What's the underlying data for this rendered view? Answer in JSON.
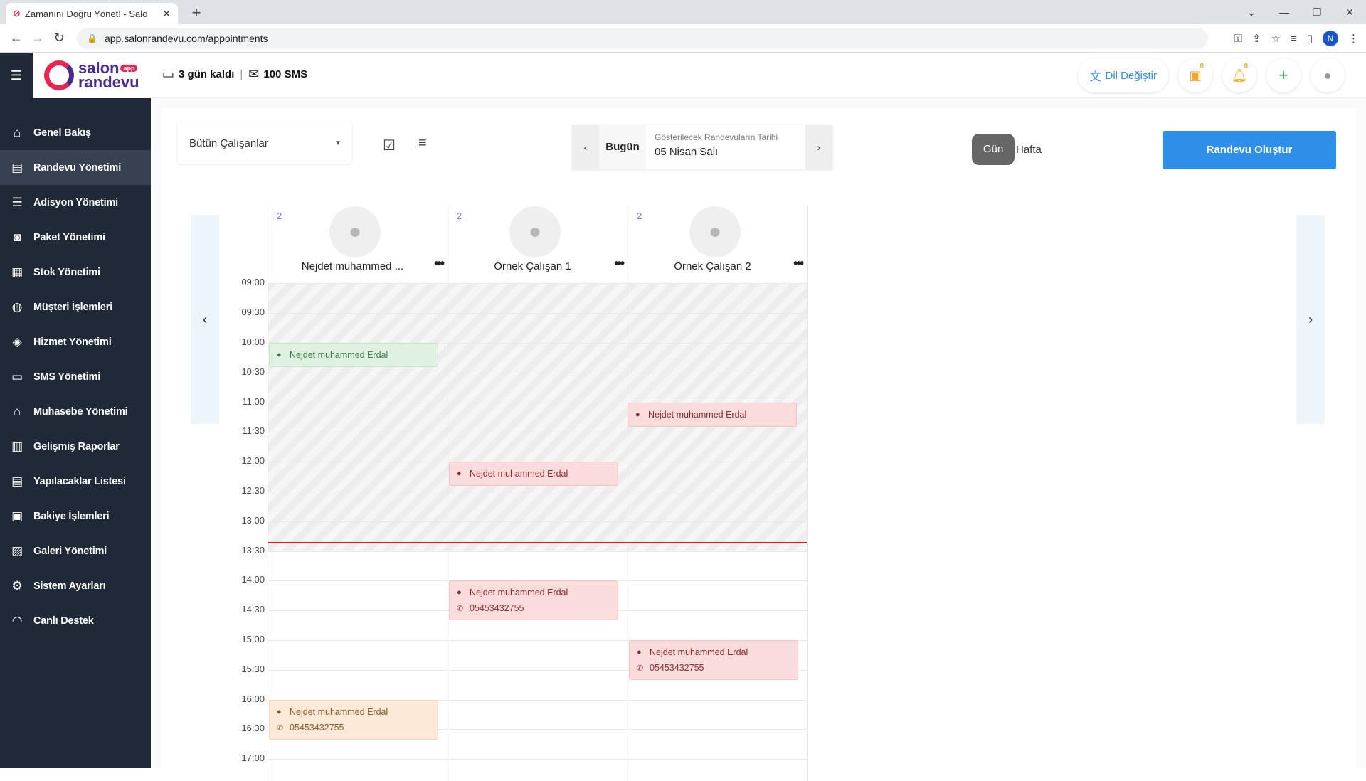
{
  "browser": {
    "tab_title": "Zamanını Doğru Yönet! - Salo",
    "url": "app.salonrandevu.com/appointments",
    "profile_initial": "N"
  },
  "header": {
    "logo_line1": "salon",
    "logo_line2": "randevu",
    "logo_badge": "app",
    "trial": "3 gün kaldı",
    "sms": "100 SMS",
    "lang_label": "Dil Değiştir",
    "calendar_badge": "0",
    "notif_badge": "0"
  },
  "sidebar": {
    "items": [
      {
        "label": "Genel Bakış",
        "icon": "home-icon"
      },
      {
        "label": "Randevu Yönetimi",
        "icon": "calendar-icon"
      },
      {
        "label": "Adisyon Yönetimi",
        "icon": "list-icon"
      },
      {
        "label": "Paket Yönetimi",
        "icon": "bag-icon"
      },
      {
        "label": "Stok Yönetimi",
        "icon": "store-icon"
      },
      {
        "label": "Müşteri İşlemleri",
        "icon": "users-icon"
      },
      {
        "label": "Hizmet Yönetimi",
        "icon": "layers-icon"
      },
      {
        "label": "SMS Yönetimi",
        "icon": "chat-icon"
      },
      {
        "label": "Muhasebe Yönetimi",
        "icon": "bank-icon"
      },
      {
        "label": "Gelişmiş Raporlar",
        "icon": "chart-icon"
      },
      {
        "label": "Yapılacaklar Listesi",
        "icon": "checklist-icon"
      },
      {
        "label": "Bakiye İşlemleri",
        "icon": "wallet-icon"
      },
      {
        "label": "Galeri Yönetimi",
        "icon": "image-icon"
      },
      {
        "label": "Sistem Ayarları",
        "icon": "gear-icon"
      },
      {
        "label": "Canlı Destek",
        "icon": "headset-icon"
      }
    ]
  },
  "toolbar": {
    "employee_select": "Bütün Çalışanlar",
    "today": "Bugün",
    "date_label": "Gösterilecek Randevuların Tarihi",
    "date_value": "05 Nisan Salı",
    "view_day": "Gün",
    "view_week": "Hafta",
    "create": "Randevu Oluştur"
  },
  "columns": [
    {
      "name": "Nejdet muhammed ...",
      "count": "2"
    },
    {
      "name": "Örnek Çalışan 1",
      "count": "2"
    },
    {
      "name": "Örnek Çalışan 2",
      "count": "2"
    }
  ],
  "times": [
    "09:00",
    "09:30",
    "10:00",
    "10:30",
    "11:00",
    "11:30",
    "12:00",
    "12:30",
    "13:00",
    "13:30",
    "14:00",
    "14:30",
    "15:00",
    "15:30",
    "16:00",
    "16:30",
    "17:00"
  ],
  "appointments": [
    {
      "customer": "Nejdet muhammed Erdal",
      "phone": ""
    },
    {
      "customer": "Nejdet muhammed Erdal",
      "phone": ""
    },
    {
      "customer": "Nejdet muhammed Erdal",
      "phone": ""
    },
    {
      "customer": "Nejdet muhammed Erdal",
      "phone": "05453432755"
    },
    {
      "customer": "Nejdet muhammed Erdal",
      "phone": "05453432755"
    },
    {
      "customer": "Nejdet muhammed Erdal",
      "phone": "05453432755"
    }
  ]
}
